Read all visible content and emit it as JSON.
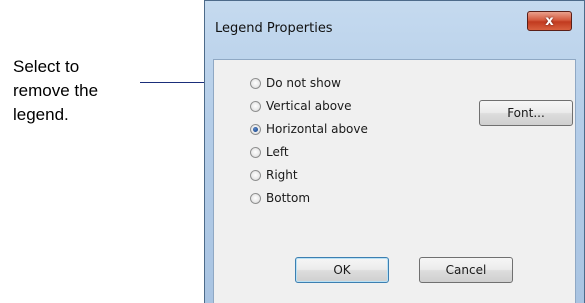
{
  "callout": {
    "lines": [
      "Select to",
      "remove the",
      "legend."
    ]
  },
  "dialog": {
    "title": "Legend Properties",
    "close_label": "x",
    "options": [
      {
        "label": "Do not show",
        "checked": false
      },
      {
        "label": "Vertical above",
        "checked": false
      },
      {
        "label": "Horizontal above",
        "checked": true
      },
      {
        "label": "Left",
        "checked": false
      },
      {
        "label": "Right",
        "checked": false
      },
      {
        "label": "Bottom",
        "checked": false
      }
    ],
    "font_button": "Font...",
    "ok_button": "OK",
    "cancel_button": "Cancel"
  },
  "colors": {
    "callout_line": "#1a2e7a",
    "close_button": "#c13a1f",
    "radio_selected": "#1c4a8f"
  }
}
